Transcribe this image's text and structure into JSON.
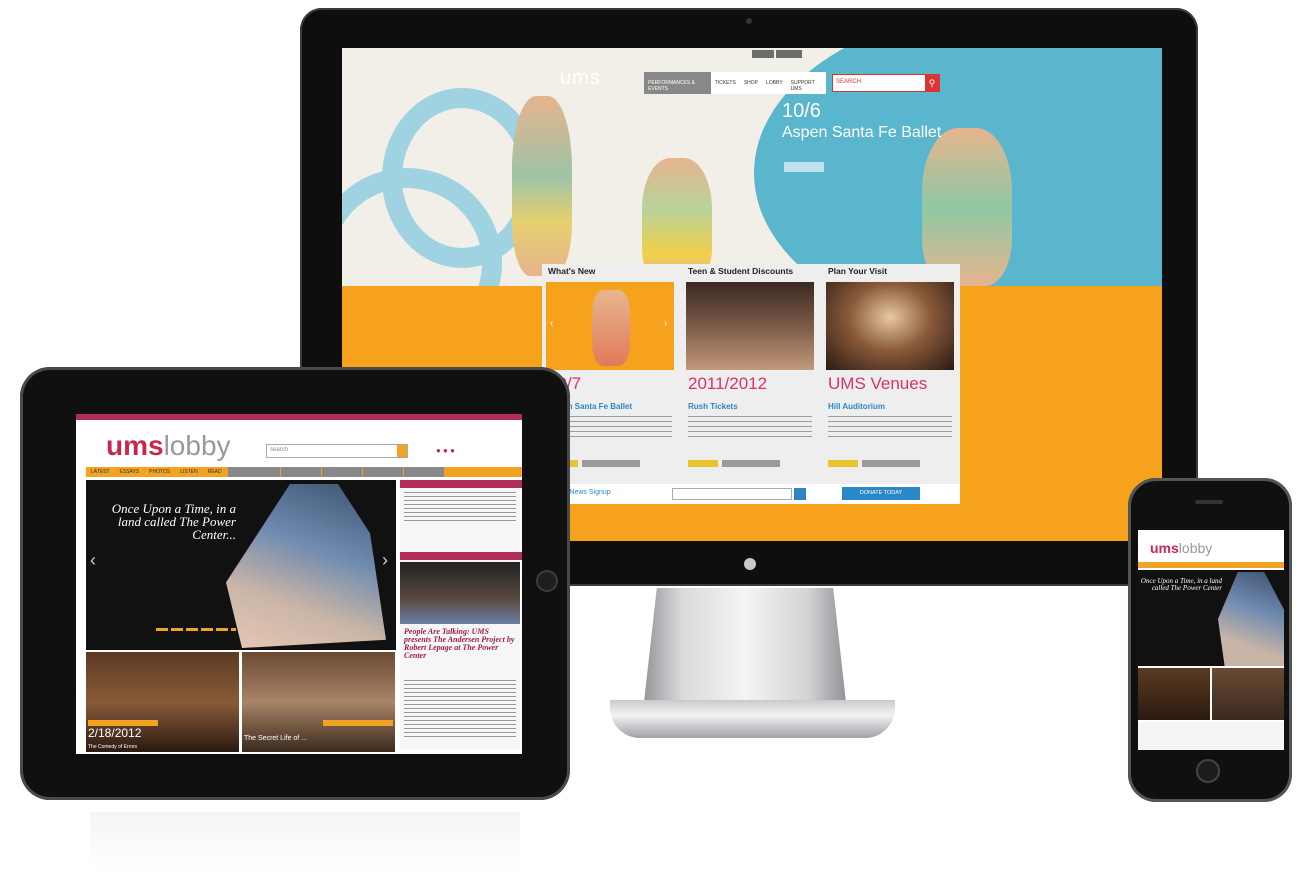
{
  "imac": {
    "site_logo": "ums",
    "topbar_links": [
      "",
      ""
    ],
    "nav": [
      "PERFORMANCES & EVENTS",
      "TICKETS",
      "SHOP",
      "LOBBY",
      "SUPPORT UMS"
    ],
    "search_placeholder": "SEARCH",
    "hero": {
      "date": "10/6",
      "title": "Aspen Santa Fe Ballet"
    },
    "panels": [
      {
        "header": "What's New",
        "big": "10/7",
        "subtitle": "",
        "title": "Aspen Santa Fe Ballet"
      },
      {
        "header": "Teen & Student Discounts",
        "big": "2011/2012",
        "subtitle": "",
        "title": "Rush Tickets"
      },
      {
        "header": "Plan Your Visit",
        "big": "UMS Venues",
        "subtitle": "",
        "title": "Hill Auditorium"
      }
    ],
    "signup": {
      "label": "UMS eNews Signup",
      "button": "DONATE TODAY"
    }
  },
  "ipad": {
    "logo_bold": "ums",
    "logo_thin": "lobby",
    "search_placeholder": "search",
    "nav": [
      "LATEST",
      "ESSAYS",
      "PHOTOS",
      "LISTEN",
      "READ"
    ],
    "hero_quote": "Once Upon a Time, in a land called The Power Center...",
    "side_headers": [
      "",
      ""
    ],
    "side_title": "People Are Talking: UMS presents The Andersen Project by Robert Lepage at The Power Center",
    "thumbs": [
      {
        "caption": "2/18/2012",
        "sub": "The Comedy of Errors"
      },
      {
        "caption": "The Secret Life of ..."
      }
    ]
  },
  "iphone": {
    "logo_bold": "ums",
    "logo_thin": "lobby",
    "hero_quote": "Once Upon a Time, in a land called The Power Center"
  },
  "colors": {
    "ums_orange": "#f6a21c",
    "ums_magenta": "#c7284e",
    "hero_blue": "#5ab6cc",
    "link_blue": "#2a87c8"
  }
}
